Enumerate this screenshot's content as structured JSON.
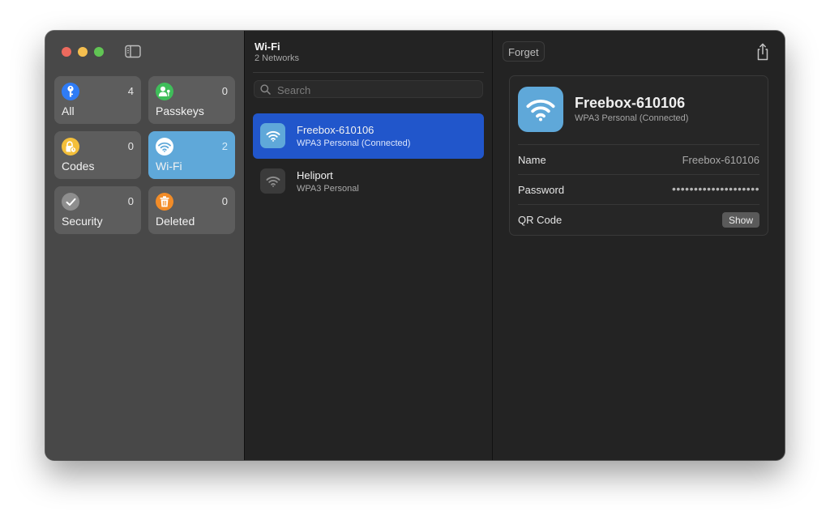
{
  "sidebar": {
    "tiles": [
      {
        "label": "All",
        "count": "4",
        "icon": "key-icon",
        "color": "#2f7cf6"
      },
      {
        "label": "Passkeys",
        "count": "0",
        "icon": "person-key-icon",
        "color": "#3fbe5a"
      },
      {
        "label": "Codes",
        "count": "0",
        "icon": "lock-clock-icon",
        "color": "#f4bf3a"
      },
      {
        "label": "Wi-Fi",
        "count": "2",
        "icon": "wifi-icon",
        "color": "#5fa8d9",
        "selected": true
      },
      {
        "label": "Security",
        "count": "0",
        "icon": "checkmark-icon",
        "color": "#8e8e8e"
      },
      {
        "label": "Deleted",
        "count": "0",
        "icon": "trash-icon",
        "color": "#f28c28"
      }
    ]
  },
  "list": {
    "title": "Wi-Fi",
    "subtitle": "2 Networks",
    "search_placeholder": "Search",
    "networks": [
      {
        "name": "Freebox-610106",
        "security": "WPA3 Personal (Connected)",
        "selected": true
      },
      {
        "name": "Heliport",
        "security": "WPA3 Personal",
        "selected": false
      }
    ]
  },
  "detail": {
    "forget_label": "Forget",
    "title": "Freebox-610106",
    "subtitle": "WPA3 Personal (Connected)",
    "rows": {
      "name_label": "Name",
      "name_value": "Freebox-610106",
      "password_label": "Password",
      "password_mask": "••••••••••••••••••••",
      "qr_label": "QR Code",
      "show_label": "Show"
    }
  },
  "colors": {
    "accent_selection": "#2156cb",
    "wifi_tile": "#5fa8d9",
    "sidebar_bg": "#484848",
    "content_bg": "#232323"
  }
}
